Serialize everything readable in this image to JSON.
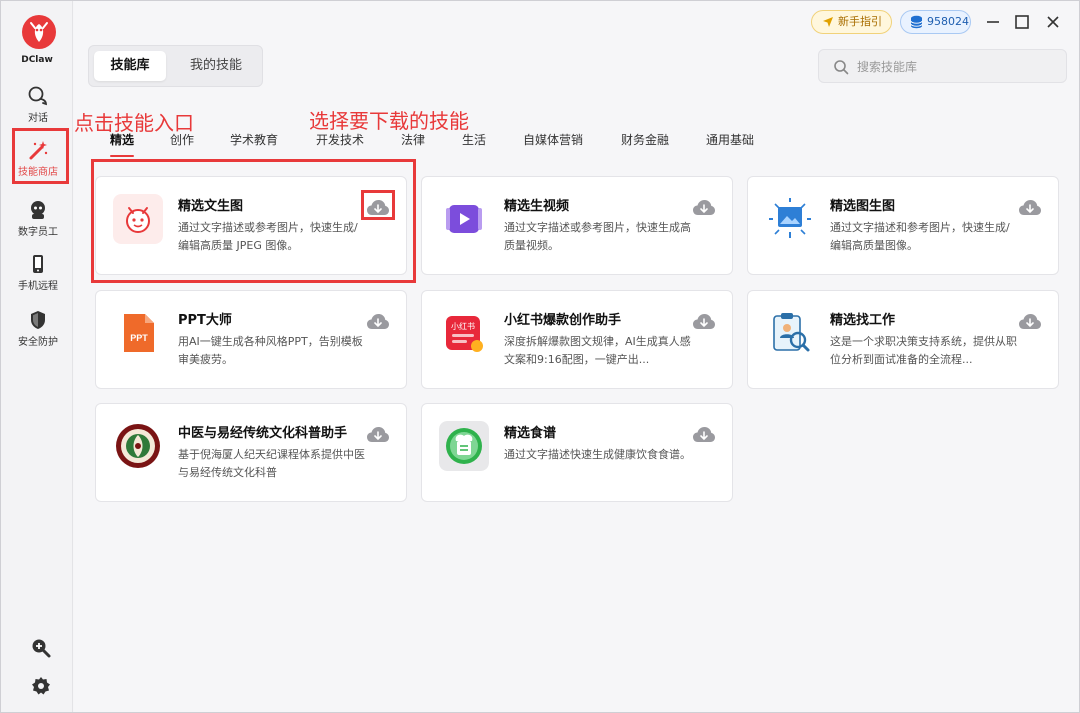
{
  "app": {
    "name": "DClaw"
  },
  "sidebar": {
    "items": [
      {
        "label": "对话",
        "icon": "chat-icon"
      },
      {
        "label": "技能商店",
        "icon": "magic-wand-icon"
      },
      {
        "label": "数字员工",
        "icon": "robot-icon"
      },
      {
        "label": "手机远程",
        "icon": "phone-icon"
      },
      {
        "label": "安全防护",
        "icon": "shield-icon"
      }
    ],
    "bottom": [
      {
        "icon": "zoom-icon"
      },
      {
        "icon": "gear-icon"
      }
    ]
  },
  "header": {
    "tabs": [
      {
        "label": "技能库",
        "active": true
      },
      {
        "label": "我的技能",
        "active": false
      }
    ],
    "guide_label": "新手指引",
    "credits": "958024",
    "search_placeholder": "搜索技能库"
  },
  "annotations": {
    "left": "点击技能入口",
    "right": "选择要下载的技能"
  },
  "categories": [
    "精选",
    "创作",
    "学术教育",
    "开发技术",
    "法律",
    "生活",
    "自媒体营销",
    "财务金融",
    "通用基础"
  ],
  "skills": [
    {
      "title": "精选文生图",
      "desc": "通过文字描述或参考图片，快速生成/编辑高质量 JPEG 图像。",
      "icon": "lobster-mascot-icon"
    },
    {
      "title": "精选生视频",
      "desc": "通过文字描述或参考图片，快速生成高质量视频。",
      "icon": "video-play-icon"
    },
    {
      "title": "精选图生图",
      "desc": "通过文字描述和参考图片，快速生成/编辑高质量图像。",
      "icon": "image-transform-icon"
    },
    {
      "title": "PPT大师",
      "desc": "用AI一键生成各种风格PPT，告别模板审美疲劳。",
      "icon": "ppt-file-icon"
    },
    {
      "title": "小红书爆款创作助手",
      "desc": "深度拆解爆款图文规律，AI生成真人感文案和9:16配图，一键产出...",
      "icon": "xiaohongshu-icon",
      "badge": "小红书"
    },
    {
      "title": "精选找工作",
      "desc": "这是一个求职决策支持系统，提供从职位分析到面试准备的全流程...",
      "icon": "resume-search-icon"
    },
    {
      "title": "中医与易经传统文化科普助手",
      "desc": "基于倪海厦人纪天纪课程体系提供中医与易经传统文化科普",
      "icon": "tcm-seal-icon"
    },
    {
      "title": "精选食谱",
      "desc": "通过文字描述快速生成健康饮食食谱。",
      "icon": "chef-recipe-icon"
    }
  ],
  "colors": {
    "accent": "#e8393a",
    "download_icon": "#9a9a9f"
  }
}
